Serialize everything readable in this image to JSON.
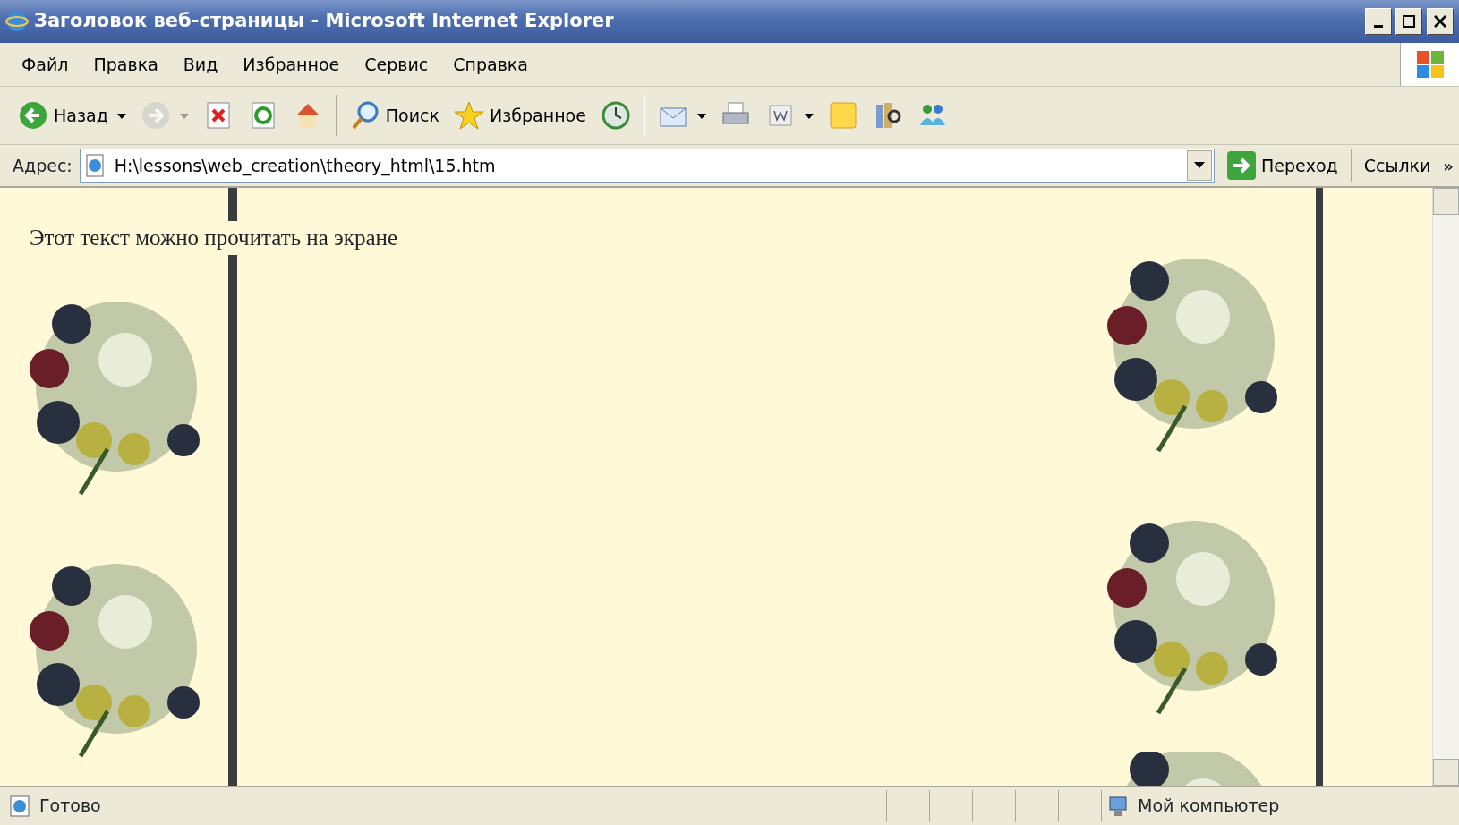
{
  "window": {
    "title": "Заголовок веб-страницы - Microsoft Internet Explorer"
  },
  "menu": [
    {
      "label": "Файл"
    },
    {
      "label": "Правка"
    },
    {
      "label": "Вид"
    },
    {
      "label": "Избранное"
    },
    {
      "label": "Сервис"
    },
    {
      "label": "Справка"
    }
  ],
  "toolbar": [
    {
      "kind": "back",
      "label": "Назад",
      "dropdown": true,
      "disabled": false
    },
    {
      "kind": "forward",
      "dropdown": true,
      "disabled": true
    },
    {
      "kind": "stop",
      "dropdown": false,
      "disabled": false
    },
    {
      "kind": "refresh",
      "dropdown": false,
      "disabled": false
    },
    {
      "kind": "home",
      "dropdown": false,
      "disabled": false
    },
    {
      "kind": "separator"
    },
    {
      "kind": "search",
      "label": "Поиск",
      "dropdown": false,
      "disabled": false
    },
    {
      "kind": "favorites",
      "label": "Избранное",
      "dropdown": false,
      "disabled": false
    },
    {
      "kind": "history",
      "dropdown": false,
      "disabled": false
    },
    {
      "kind": "separator"
    },
    {
      "kind": "mail",
      "dropdown": true,
      "disabled": false
    },
    {
      "kind": "print",
      "dropdown": false,
      "disabled": false
    },
    {
      "kind": "edit",
      "dropdown": true,
      "disabled": false
    },
    {
      "kind": "note",
      "dropdown": false,
      "disabled": false
    },
    {
      "kind": "research",
      "dropdown": false,
      "disabled": false
    },
    {
      "kind": "messenger",
      "dropdown": false,
      "disabled": false
    }
  ],
  "address_bar": {
    "label": "Адрес:",
    "value": "H:\\lessons\\web_creation\\theory_html\\15.htm",
    "go_label": "Переход",
    "links_label": "Ссылки",
    "more": "»"
  },
  "page": {
    "text": "Этот текст можно прочитать на экране"
  },
  "status_bar": {
    "text": "Готово",
    "zone": "Мой компьютер"
  }
}
